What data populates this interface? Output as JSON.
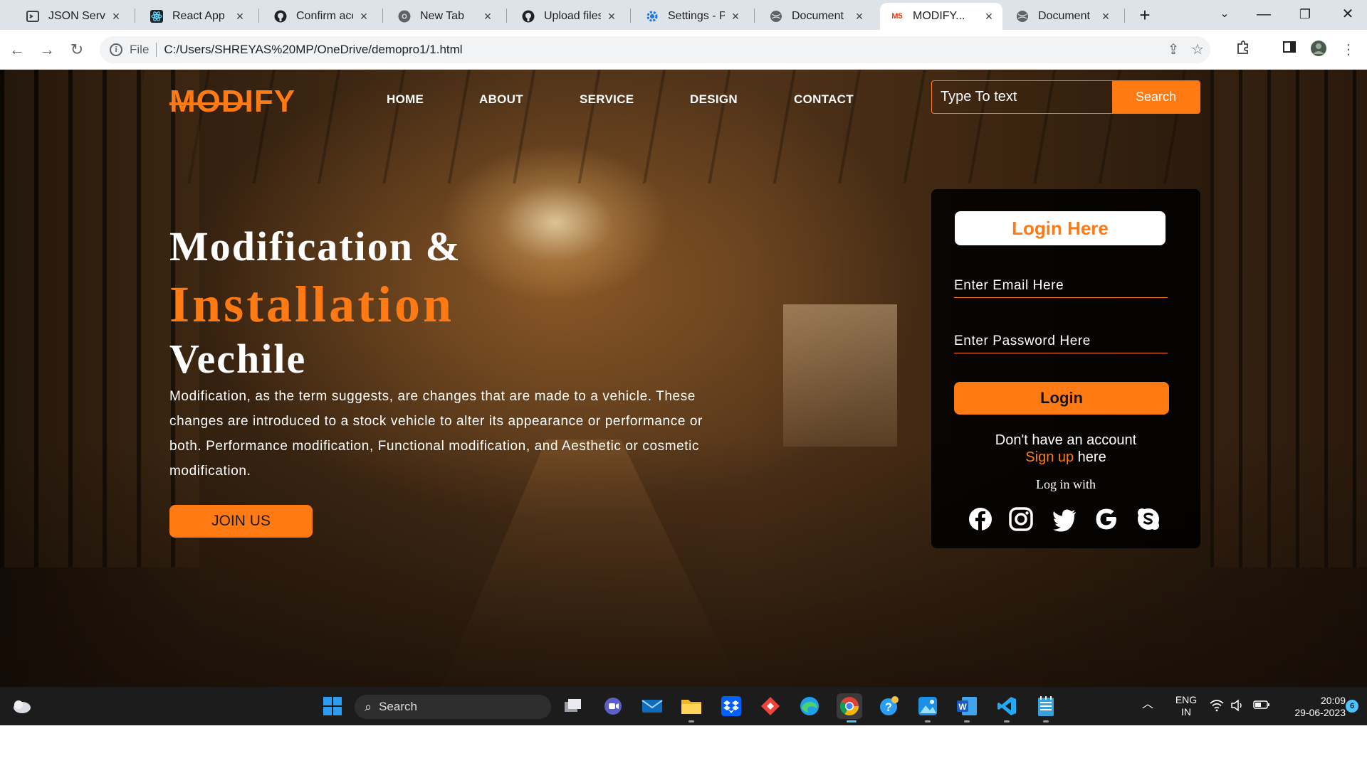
{
  "browser": {
    "tabs": [
      {
        "title": "JSON Server",
        "icon": "json-server-icon"
      },
      {
        "title": "React App",
        "icon": "react-icon"
      },
      {
        "title": "Confirm acc",
        "icon": "github-icon"
      },
      {
        "title": "New Tab",
        "icon": "chrome-icon"
      },
      {
        "title": "Upload files",
        "icon": "github-icon"
      },
      {
        "title": "Settings - Pa",
        "icon": "settings-gear-icon"
      },
      {
        "title": "Document",
        "icon": "globe-icon"
      },
      {
        "title": "MODIFY...",
        "icon": "modify-favicon"
      },
      {
        "title": "Document",
        "icon": "globe-icon"
      }
    ],
    "active_tab_index": 7,
    "modify_favicon_text": "M5",
    "address": {
      "scheme_label": "File",
      "url": "C:/Users/SHREYAS%20MP/OneDrive/demopro1/1.html"
    }
  },
  "site": {
    "logo": "MODIFY",
    "nav": [
      "HOME",
      "ABOUT",
      "SERVICE",
      "DESIGN",
      "CONTACT"
    ],
    "search": {
      "placeholder": "Type To text",
      "button": "Search"
    },
    "hero": {
      "line1": "Modification &",
      "line2": "Installation",
      "line3": "Vechile",
      "description": "Modification, as the term suggests, are changes that are made to a vehicle. These changes are introduced to a stock vehicle to alter its appearance or performance or both. Performance modification, Functional modification, and Aesthetic or cosmetic modification.",
      "cta": "JOIN US"
    },
    "login": {
      "title": "Login Here",
      "email_placeholder": "Enter Email Here",
      "password_placeholder": "Enter Password Here",
      "button": "Login",
      "no_account": "Don't have an account",
      "signup_link": "Sign up",
      "signup_suffix": " here",
      "login_with": "Log in with",
      "socials": [
        "facebook-icon",
        "instagram-icon",
        "twitter-icon",
        "google-icon",
        "skype-icon"
      ]
    }
  },
  "taskbar": {
    "search_label": "Search",
    "apps": [
      "windows-start-icon",
      "task-view-icon",
      "teams-chat-icon",
      "mail-icon",
      "file-explorer-icon",
      "dropbox-icon",
      "anydesk-icon",
      "edge-icon",
      "chrome-icon",
      "help-icon",
      "photos-icon",
      "word-icon",
      "vscode-icon",
      "notepad-icon"
    ],
    "language": "ENG",
    "region": "IN",
    "time": "20:09",
    "date": "29-06-2023",
    "notification_count": "6"
  },
  "colors": {
    "accent": "#ff7a12",
    "taskbar": "#1c1c1c",
    "tab_strip": "#dee3ea"
  }
}
